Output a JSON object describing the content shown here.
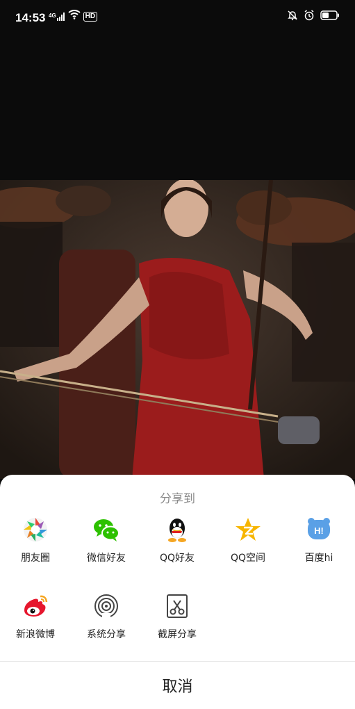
{
  "status_bar": {
    "time": "14:53",
    "network_label": "4G",
    "hd_label": "HD"
  },
  "share_sheet": {
    "title": "分享到",
    "items": [
      {
        "label": "朋友圈",
        "icon": "moments-icon"
      },
      {
        "label": "微信好友",
        "icon": "wechat-icon"
      },
      {
        "label": "QQ好友",
        "icon": "qq-icon"
      },
      {
        "label": "QQ空间",
        "icon": "qzone-icon"
      },
      {
        "label": "百度hi",
        "icon": "baidu-hi-icon"
      },
      {
        "label": "新浪微博",
        "icon": "weibo-icon"
      },
      {
        "label": "系统分享",
        "icon": "system-share-icon"
      },
      {
        "label": "截屏分享",
        "icon": "screenshot-share-icon"
      }
    ],
    "cancel_label": "取消"
  }
}
